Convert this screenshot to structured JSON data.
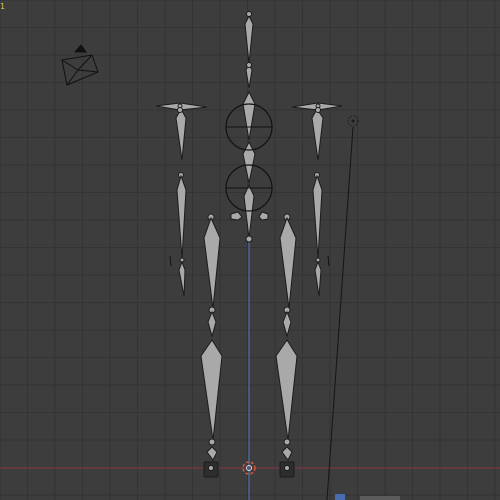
{
  "viewport": {
    "corner_label": "1",
    "background": "#3d3d3d",
    "grid_color": "#343434",
    "x_axis_color": "#8a3c46",
    "z_axis_color": "#4a6db0",
    "bone_fill": "#a9a9a9",
    "bone_stroke": "#1c1c1c"
  },
  "icons": {
    "camera": "camera-icon",
    "light": "light-icon",
    "cursor": "3d-cursor-icon"
  }
}
